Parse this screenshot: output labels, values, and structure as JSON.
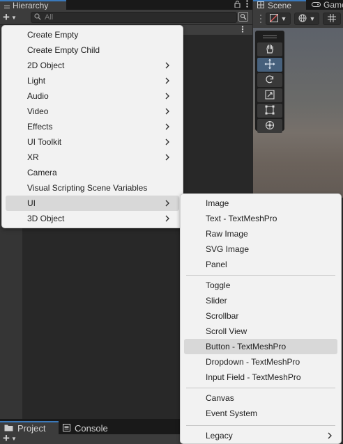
{
  "hierarchy": {
    "tab_title": "Hierarchy",
    "search_placeholder": "All"
  },
  "scene": {
    "tab_scene": "Scene",
    "tab_game": "Game"
  },
  "bottom": {
    "tab_project": "Project",
    "tab_console": "Console"
  },
  "create_menu": {
    "items": [
      {
        "label": "Create Empty",
        "has_submenu": false
      },
      {
        "label": "Create Empty Child",
        "has_submenu": false
      },
      {
        "label": "2D Object",
        "has_submenu": true
      },
      {
        "label": "Light",
        "has_submenu": true
      },
      {
        "label": "Audio",
        "has_submenu": true
      },
      {
        "label": "Video",
        "has_submenu": true
      },
      {
        "label": "Effects",
        "has_submenu": true
      },
      {
        "label": "UI Toolkit",
        "has_submenu": true
      },
      {
        "label": "XR",
        "has_submenu": true
      },
      {
        "label": "Camera",
        "has_submenu": false
      },
      {
        "label": "Visual Scripting Scene Variables",
        "has_submenu": false
      },
      {
        "label": "UI",
        "has_submenu": true,
        "highlighted": true
      },
      {
        "label": "3D Object",
        "has_submenu": true
      }
    ]
  },
  "ui_submenu": {
    "group1": [
      "Image",
      "Text - TextMeshPro",
      "Raw Image",
      "SVG Image",
      "Panel"
    ],
    "group2": [
      "Toggle",
      "Slider",
      "Scrollbar",
      "Scroll View",
      "Button - TextMeshPro",
      "Dropdown - TextMeshPro",
      "Input Field - TextMeshPro"
    ],
    "group3": [
      "Canvas",
      "Event System"
    ],
    "group4": [
      "Legacy"
    ],
    "highlighted_item": "Button - TextMeshPro"
  },
  "colors": {
    "accent": "#3a79bb",
    "menu_bg": "#f2f2f2",
    "menu_highlight": "#d8d8d8",
    "editor_bg": "#282828"
  }
}
